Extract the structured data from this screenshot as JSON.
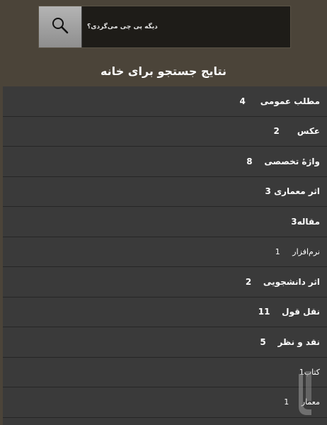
{
  "search": {
    "placeholder": "دیگه پی چی می‌گردی؟",
    "button_icon": "search-icon"
  },
  "title": "نتایج جستجو برای خانه",
  "results": [
    {
      "label": "4     مطلب عمومی"
    },
    {
      "label": "2      عکس"
    },
    {
      "label": "8    واژهٔ تخصصی"
    },
    {
      "label": "3 اثر معماری"
    },
    {
      "label": "3مقاله"
    },
    {
      "label": "1     نرم‌افزار"
    },
    {
      "label": "2    اثر دانشجویی"
    },
    {
      "label": "11    نقل قول"
    },
    {
      "label": "5    نقد و نظر"
    },
    {
      "label": "1کتاب"
    },
    {
      "label": "1     معمار"
    }
  ],
  "colors": {
    "background": "#4b4439",
    "list_background": "#3a3a3a",
    "row_divider": "#262626",
    "text": "#ffffff"
  }
}
